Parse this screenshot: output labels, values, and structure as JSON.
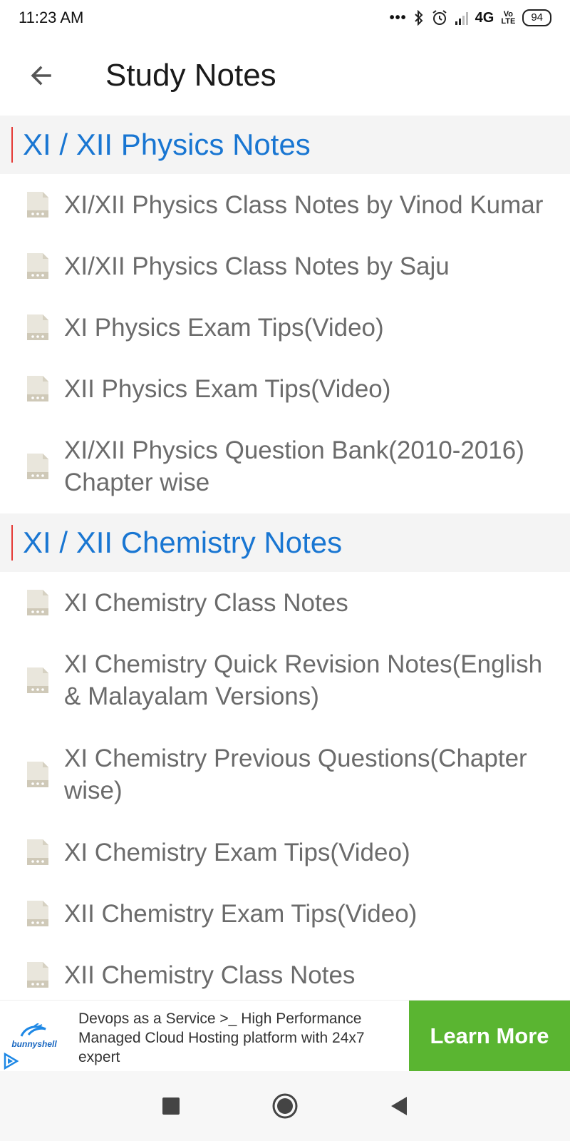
{
  "status_bar": {
    "time": "11:23 AM",
    "network": "4G",
    "volte_top": "Vo",
    "volte_bottom": "LTE",
    "battery": "94",
    "icons": [
      "bluetooth-icon",
      "alarm-icon",
      "signal-icon"
    ]
  },
  "app_bar": {
    "title": "Study Notes",
    "back_icon": "arrow-left-icon"
  },
  "sections": {
    "physics": {
      "title": "XI / XII Physics Notes",
      "items": [
        "XI/XII Physics Class Notes by Vinod Kumar",
        "XI/XII Physics Class Notes by Saju",
        "XI Physics Exam Tips(Video)",
        "XII Physics Exam Tips(Video)",
        "XI/XII Physics Question Bank(2010-2016) Chapter wise"
      ]
    },
    "chemistry": {
      "title": "XI / XII Chemistry Notes",
      "items": [
        "XI Chemistry Class Notes",
        "XI Chemistry Quick Revision Notes(English & Malayalam Versions)",
        "XI Chemistry Previous Questions(Chapter wise)",
        "XI Chemistry Exam Tips(Video)",
        "XII Chemistry Exam Tips(Video)",
        "XII Chemistry Class Notes"
      ]
    }
  },
  "ad": {
    "logo_text": "bunnyshell",
    "text": "Devops as a Service >_ High Performance Managed Cloud Hosting platform with 24x7 expert",
    "cta": "Learn More"
  },
  "colors": {
    "section_title": "#1976d2",
    "section_bar": "#e53935",
    "section_bg": "#f4f4f4",
    "item_text": "#6b6b6b",
    "cta_bg": "#5ab531"
  }
}
